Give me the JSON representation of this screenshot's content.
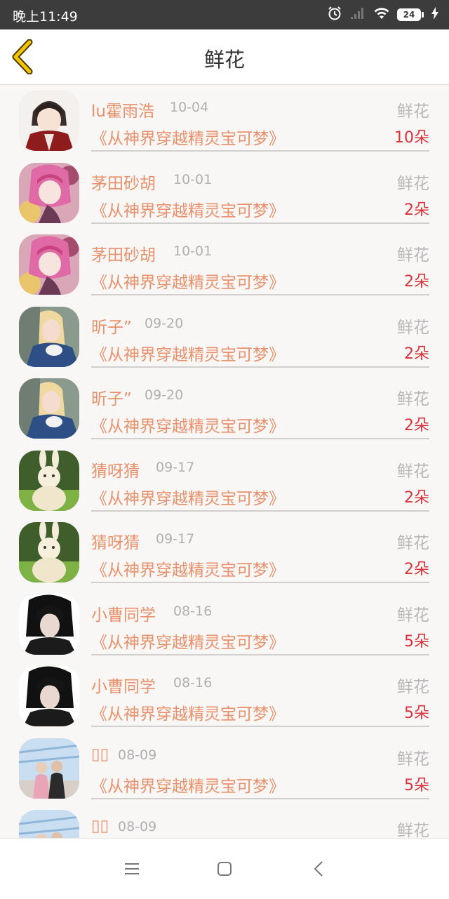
{
  "status_bar": {
    "time": "晚上11:49",
    "battery": "24",
    "icons": [
      "alarm-icon",
      "signal-icon",
      "wifi-icon",
      "battery-icon",
      "charging-icon"
    ]
  },
  "header": {
    "title": "鲜花",
    "back_icon": "chevron-left-icon",
    "accent": "#f5c400"
  },
  "colors": {
    "name": "#e8916a",
    "date": "#b0b0b0",
    "gift": "#b7b7b7",
    "count": "#d9323a"
  },
  "rows": [
    {
      "name": "lu霍雨浩",
      "date": "10-04",
      "gift": "鲜花",
      "book": "《从神界穿越精灵宝可梦》",
      "count": "10朵",
      "avatar": "avatar-anime-boy"
    },
    {
      "name": "茅田砂胡",
      "date": "10-01",
      "gift": "鲜花",
      "book": "《从神界穿越精灵宝可梦》",
      "count": "2朵",
      "avatar": "avatar-anime-girl-pink"
    },
    {
      "name": "茅田砂胡",
      "date": "10-01",
      "gift": "鲜花",
      "book": "《从神界穿越精灵宝可梦》",
      "count": "2朵",
      "avatar": "avatar-anime-girl-pink"
    },
    {
      "name": "昕子”",
      "date": "09-20",
      "gift": "鲜花",
      "book": "《从神界穿越精灵宝可梦》",
      "count": "2朵",
      "avatar": "avatar-blonde-girl"
    },
    {
      "name": "昕子”",
      "date": "09-20",
      "gift": "鲜花",
      "book": "《从神界穿越精灵宝可梦》",
      "count": "2朵",
      "avatar": "avatar-blonde-girl"
    },
    {
      "name": "猜呀猜",
      "date": "09-17",
      "gift": "鲜花",
      "book": "《从神界穿越精灵宝可梦》",
      "count": "2朵",
      "avatar": "avatar-bunny-plush"
    },
    {
      "name": "猜呀猜",
      "date": "09-17",
      "gift": "鲜花",
      "book": "《从神界穿越精灵宝可梦》",
      "count": "2朵",
      "avatar": "avatar-bunny-plush"
    },
    {
      "name": "小曹同学",
      "date": "08-16",
      "gift": "鲜花",
      "book": "《从神界穿越精灵宝可梦》",
      "count": "5朵",
      "avatar": "avatar-dark-hair"
    },
    {
      "name": "小曹同学",
      "date": "08-16",
      "gift": "鲜花",
      "book": "《从神界穿越精灵宝可梦》",
      "count": "5朵",
      "avatar": "avatar-dark-hair"
    },
    {
      "name": "▯▯",
      "date": "08-09",
      "gift": "鲜花",
      "book": "《从神界穿越精灵宝可梦》",
      "count": "5朵",
      "avatar": "avatar-couple-photo"
    },
    {
      "name": "▯▯",
      "date": "08-09",
      "gift": "鲜花",
      "book": "",
      "count": "",
      "avatar": "avatar-couple-photo"
    }
  ],
  "bottom_bar": {
    "buttons": [
      "menu-icon",
      "home-icon",
      "back-icon"
    ]
  }
}
